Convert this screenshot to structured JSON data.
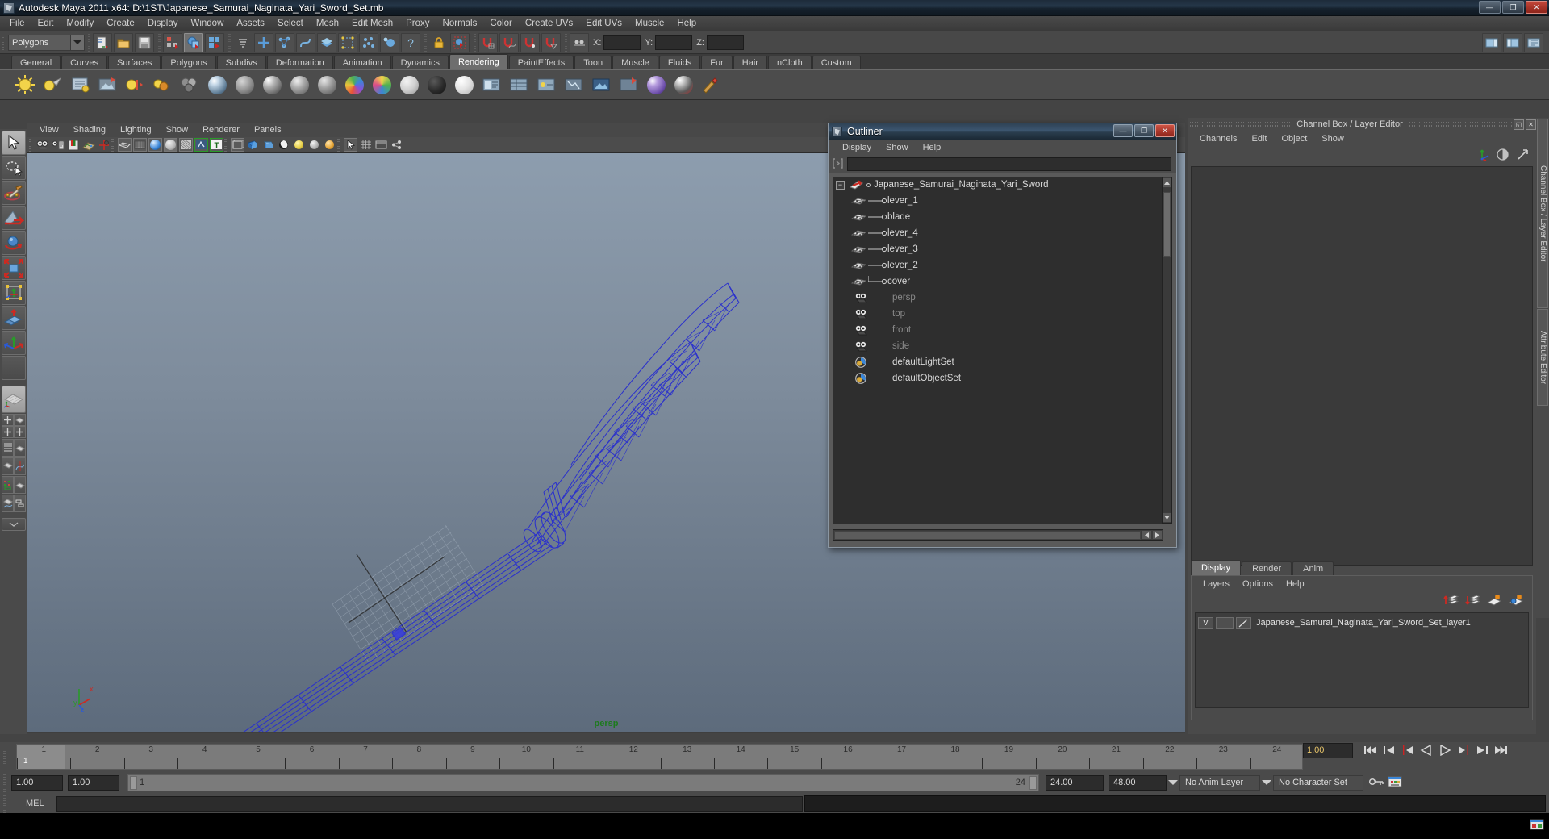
{
  "window": {
    "title": "Autodesk Maya 2011 x64: D:\\1ST\\Japanese_Samurai_Naginata_Yari_Sword_Set.mb",
    "app_icon": "maya-icon",
    "buttons": {
      "minimize": "—",
      "restore": "❐",
      "close": "✕"
    }
  },
  "main_menu": {
    "items": [
      "File",
      "Edit",
      "Modify",
      "Create",
      "Display",
      "Window",
      "Assets",
      "Select",
      "Mesh",
      "Edit Mesh",
      "Proxy",
      "Normals",
      "Color",
      "Create UVs",
      "Edit UVs",
      "Muscle",
      "Help"
    ]
  },
  "status_line": {
    "menu_set": "Polygons",
    "x_label": "X:",
    "y_label": "Y:",
    "z_label": "Z:",
    "x_value": "",
    "y_value": "",
    "z_value": ""
  },
  "shelf": {
    "tabs": [
      "General",
      "Curves",
      "Surfaces",
      "Polygons",
      "Subdivs",
      "Deformation",
      "Animation",
      "Dynamics",
      "Rendering",
      "PaintEffects",
      "Toon",
      "Muscle",
      "Fluids",
      "Fur",
      "Hair",
      "nCloth",
      "Custom"
    ],
    "active_tab": "Rendering"
  },
  "viewport": {
    "menus": [
      "View",
      "Shading",
      "Lighting",
      "Show",
      "Renderer",
      "Panels"
    ],
    "camera_label": "persp",
    "camera_label_color": "#1d7a1d",
    "background_top": "#8d9dae",
    "background_bottom": "#5d6b7c",
    "wireframe_color": "#2b31cc",
    "axis_labels": {
      "x": "x",
      "y": "y",
      "z": "z"
    }
  },
  "outliner": {
    "title": "Outliner",
    "icon": "maya-icon",
    "menus": [
      "Display",
      "Show",
      "Help"
    ],
    "search_value": "",
    "search_placeholder": "",
    "window_buttons": {
      "minimize": "—",
      "restore": "❐",
      "close": "✕"
    },
    "items": [
      {
        "label": "Japanese_Samurai_Naginata_Yari_Sword",
        "icon": "transform-group-icon",
        "depth": 0,
        "expanded": true,
        "dim": false
      },
      {
        "label": "lever_1",
        "icon": "mesh-icon",
        "depth": 1,
        "dim": false
      },
      {
        "label": "blade",
        "icon": "mesh-icon",
        "depth": 1,
        "dim": false
      },
      {
        "label": "lever_4",
        "icon": "mesh-icon",
        "depth": 1,
        "dim": false
      },
      {
        "label": "lever_3",
        "icon": "mesh-icon",
        "depth": 1,
        "dim": false
      },
      {
        "label": "lever_2",
        "icon": "mesh-icon",
        "depth": 1,
        "dim": false
      },
      {
        "label": "cover",
        "icon": "mesh-icon",
        "depth": 1,
        "dim": false
      },
      {
        "label": "persp",
        "icon": "camera-icon",
        "depth": 0,
        "dim": true
      },
      {
        "label": "top",
        "icon": "camera-icon",
        "depth": 0,
        "dim": true
      },
      {
        "label": "front",
        "icon": "camera-icon",
        "depth": 0,
        "dim": true
      },
      {
        "label": "side",
        "icon": "camera-icon",
        "depth": 0,
        "dim": true
      },
      {
        "label": "defaultLightSet",
        "icon": "set-icon",
        "depth": 0,
        "dim": false
      },
      {
        "label": "defaultObjectSet",
        "icon": "set-icon",
        "depth": 0,
        "dim": false
      }
    ]
  },
  "channel_box": {
    "panel_title": "Channel Box / Layer Editor",
    "menus": [
      "Channels",
      "Edit",
      "Object",
      "Show"
    ],
    "icons": [
      "transform-axis-icon",
      "halfmoon-icon",
      "arrow-up-right-icon"
    ],
    "window_buttons": {
      "restore": "◱",
      "close": "✕"
    },
    "side_tabs": [
      "Channel Box / Layer Editor",
      "Attribute Editor"
    ]
  },
  "layer_editor": {
    "tabs": [
      "Display",
      "Render",
      "Anim"
    ],
    "active_tab": "Display",
    "menus": [
      "Layers",
      "Options",
      "Help"
    ],
    "toolbar_icons": [
      "move-layer-up-icon",
      "move-layer-down-icon",
      "new-layer-icon",
      "new-layer-from-selected-icon"
    ],
    "layers": [
      {
        "visibility": "V",
        "shading": "",
        "name": "Japanese_Samurai_Naginata_Yari_Sword_Set_layer1"
      }
    ]
  },
  "time_slider": {
    "current_frame_marker": "1",
    "ticks": [
      "1",
      "2",
      "3",
      "4",
      "5",
      "6",
      "7",
      "8",
      "9",
      "10",
      "11",
      "12",
      "13",
      "14",
      "15",
      "16",
      "17",
      "18",
      "19",
      "20",
      "21",
      "22",
      "23",
      "24"
    ],
    "current_time_field": "1.00",
    "playback_buttons": [
      "go-to-start-icon",
      "step-back-frame-icon",
      "step-back-key-icon",
      "play-backwards-icon",
      "play-forwards-icon",
      "step-forward-key-icon",
      "step-forward-frame-icon",
      "go-to-end-icon"
    ]
  },
  "range_slider": {
    "anim_start": "1.00",
    "range_start": "1.00",
    "bar_left_label": "1",
    "bar_right_label": "24",
    "range_end": "24.00",
    "anim_end": "48.00",
    "anim_layer": "No Anim Layer",
    "character_set": "No Character Set",
    "extra_icons": [
      "key-icon",
      "auto-keyframe-icon"
    ]
  },
  "command_line": {
    "language_label": "MEL",
    "input_value": "",
    "help_icon": "help-book-icon"
  },
  "toolbox": {
    "items": [
      {
        "name": "select-tool",
        "icon": "arrow-cursor-icon",
        "selected": true
      },
      {
        "name": "lasso-select-tool",
        "icon": "lasso-icon",
        "selected": false
      },
      {
        "name": "paint-select-tool",
        "icon": "paintbrush-icon",
        "selected": false
      },
      {
        "name": "move-tool",
        "icon": "move-arrows-icon",
        "selected": false
      },
      {
        "name": "rotate-tool",
        "icon": "rotate-sphere-icon",
        "selected": false
      },
      {
        "name": "scale-tool",
        "icon": "scale-cube-icon",
        "selected": false
      },
      {
        "name": "universal-manipulator",
        "icon": "universal-manip-icon",
        "selected": false
      },
      {
        "name": "soft-modification-tool",
        "icon": "soft-mod-icon",
        "selected": false
      },
      {
        "name": "show-manipulator-tool",
        "icon": "manipulator-icon",
        "selected": false
      },
      {
        "name": "last-tool-used",
        "icon": "blank-icon",
        "selected": false
      }
    ],
    "layout_presets": [
      "single-perspective-view",
      "four-view",
      "outliner-persp",
      "hypergraph-persp",
      "graph-editor-persp",
      "render-view-persp",
      "hypershade-persp"
    ]
  }
}
